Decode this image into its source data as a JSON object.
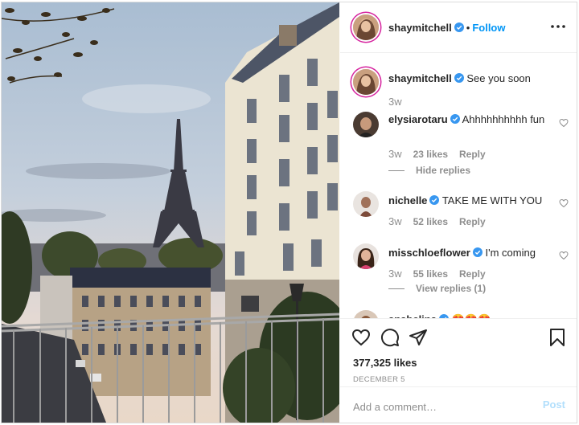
{
  "post": {
    "author": "shaymitchell",
    "follow_label": "Follow",
    "separator": "•"
  },
  "caption": {
    "username": "shaymitchell",
    "text": "See you soon",
    "age": "3w"
  },
  "comments": [
    {
      "username": "elysiarotaru",
      "text": "Ahhhhhhhhhh fun",
      "age": "3w",
      "likes": "23 likes",
      "reply": "Reply",
      "replies_toggle": "Hide replies"
    },
    {
      "username": "nichelle",
      "text": "TAKE ME WITH YOU",
      "age": "3w",
      "likes": "52 likes",
      "reply": "Reply"
    },
    {
      "username": "misschloeflower",
      "text": "I'm coming",
      "age": "3w",
      "likes": "55 likes",
      "reply": "Reply",
      "replies_toggle": "View replies (1)"
    },
    {
      "username": "anabelina",
      "text": "😍😍😍"
    }
  ],
  "stats": {
    "likes": "377,325 likes",
    "date": "DECEMBER 5"
  },
  "compose": {
    "placeholder": "Add a comment…",
    "post_label": "Post"
  },
  "icons": {
    "more": "more-options-icon",
    "like": "heart-icon",
    "comment": "comment-icon",
    "share": "share-icon",
    "save": "bookmark-icon",
    "verified": "verified-badge-icon"
  },
  "colors": {
    "accent": "#0095f6",
    "post_disabled": "#b2dffc",
    "verified": "#3897f0",
    "muted": "#8e8e8e"
  }
}
